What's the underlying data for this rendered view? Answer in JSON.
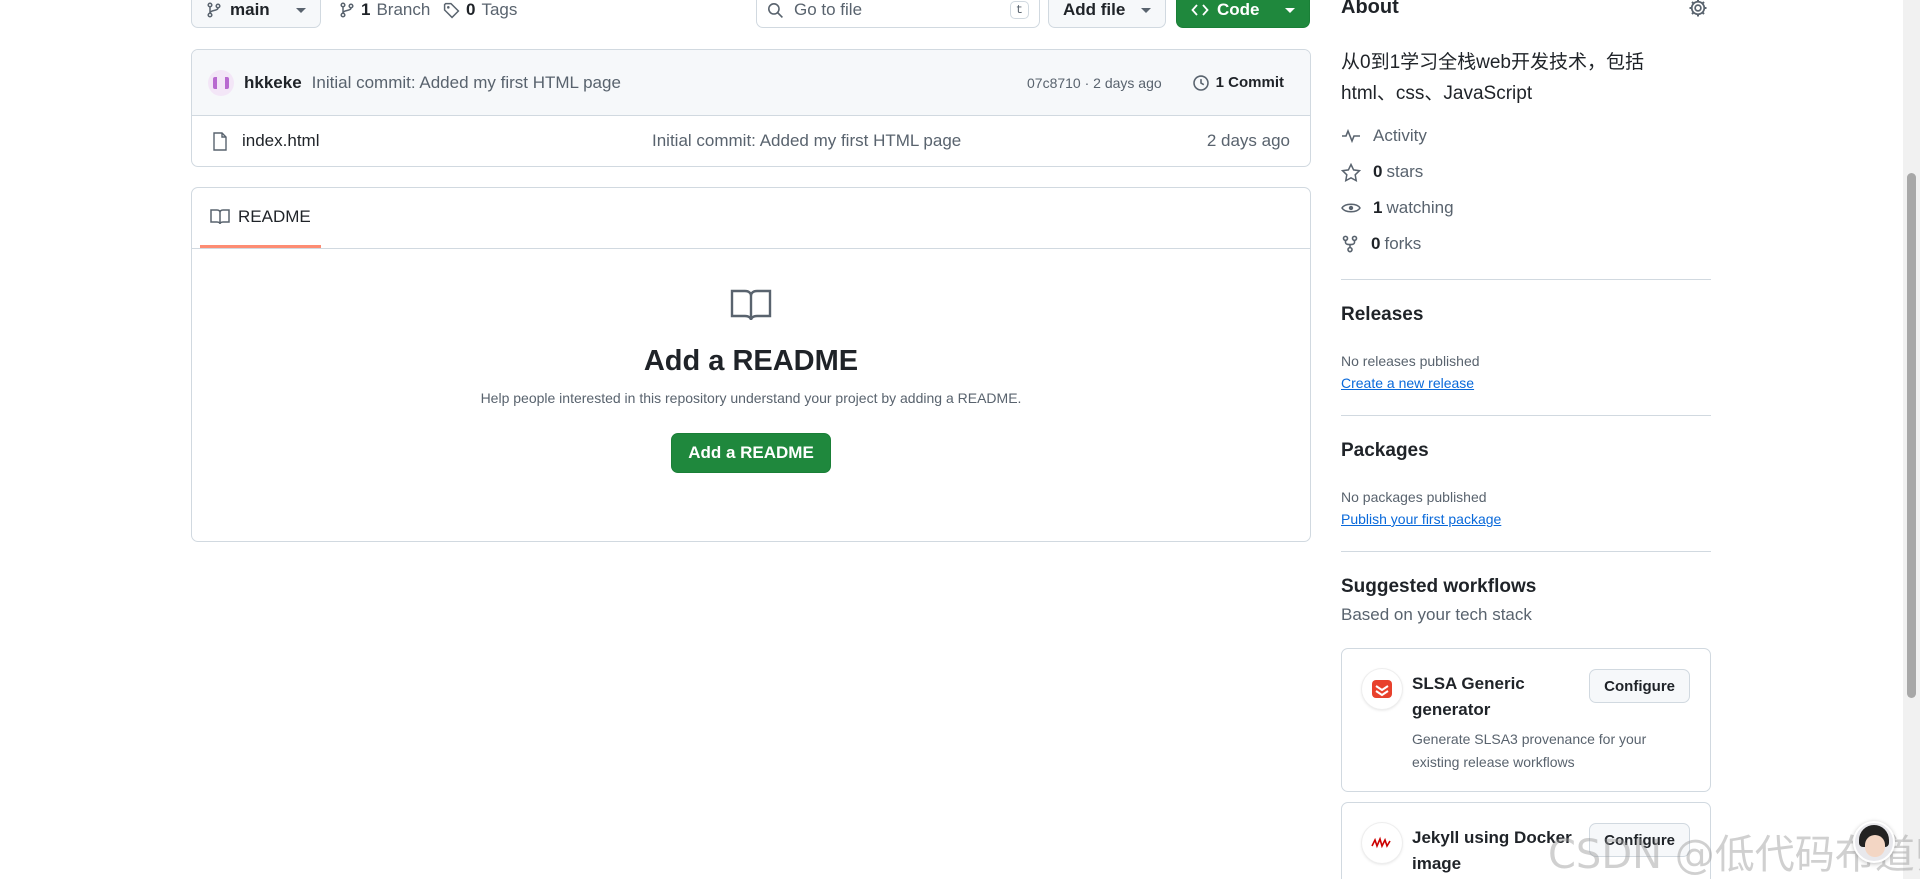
{
  "toolbar": {
    "branch": "main",
    "branches_count": "1",
    "branches_label": "Branch",
    "tags_count": "0",
    "tags_label": "Tags",
    "goto_placeholder": "Go to file",
    "goto_shortcut": "t",
    "add_file_label": "Add file",
    "code_label": "Code"
  },
  "commit": {
    "author": "hkkeke",
    "message": "Initial commit: Added my first HTML page",
    "meta": "07c8710 · 2 days ago",
    "count_label": "1 Commit"
  },
  "files": [
    {
      "name": "index.html",
      "message": "Initial commit: Added my first HTML page",
      "time": "2 days ago"
    }
  ],
  "readme": {
    "tab_label": "README",
    "title": "Add a README",
    "description": "Help people interested in this repository understand your project by adding a README.",
    "button_label": "Add a README"
  },
  "about": {
    "title": "About",
    "description": "从0到1学习全栈web开发技术，包括html、css、JavaScript",
    "activity_label": "Activity",
    "stars_count": "0",
    "stars_label": "stars",
    "watching_count": "1",
    "watching_label": "watching",
    "forks_count": "0",
    "forks_label": "forks"
  },
  "releases": {
    "title": "Releases",
    "note": "No releases published",
    "link": "Create a new release"
  },
  "packages": {
    "title": "Packages",
    "note": "No packages published",
    "link": "Publish your first package"
  },
  "workflows": {
    "title": "Suggested workflows",
    "subtitle": "Based on your tech stack",
    "items": [
      {
        "name": "SLSA Generic generator",
        "description": "Generate SLSA3 provenance for your existing release workflows",
        "button": "Configure"
      },
      {
        "name": "Jekyll using Docker image",
        "description": "",
        "button": "Configure"
      }
    ]
  },
  "watermark": "CSDN @低代码布道师",
  "colors": {
    "accent_green": "#1f883d",
    "link_blue": "#0969da",
    "tab_underline": "#fd8c73"
  }
}
